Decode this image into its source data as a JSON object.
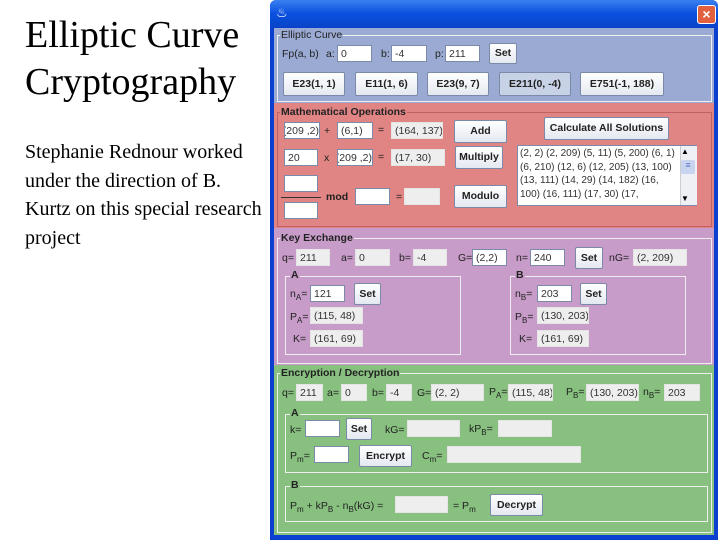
{
  "slide": {
    "title_line1": "Elliptic Curve",
    "title_line2": "Cryptography",
    "body": "Stephanie Rednour worked under the direction of B. Kurtz on this special research project"
  },
  "window": {
    "close_icon": "×",
    "app_icon": "java-cup-icon"
  },
  "colors": {
    "curve_panel": "#9aaad2",
    "math_panel": "#e08484",
    "key_panel": "#c89cc8",
    "enc_panel": "#88c080",
    "titlebar": "#0a50e0"
  },
  "curve": {
    "title": "Elliptic Curve",
    "fp_label": "Fp(a, b)",
    "a_label": "a:",
    "a": "0",
    "b_label": "b:",
    "b": "-4",
    "p_label": "p:",
    "p": "211",
    "set": "Set",
    "presets": [
      "E23(1, 1)",
      "E11(1, 6)",
      "E23(9, 7)",
      "E211(0, -4)",
      "E751(-1, 188)"
    ]
  },
  "math": {
    "title": "Mathematical Operations",
    "add_p1": "(2, 209)",
    "plus": "+",
    "add_p2": "(6,1)",
    "eq": "=",
    "add_result": "(164, 137)",
    "add": "Add",
    "mul_k": "20",
    "times": "x",
    "mul_p": "(2, 209)",
    "mul_result": "(17, 30)",
    "multiply": "Multiply",
    "num": "",
    "den": "",
    "mod_label": "mod",
    "mod": "",
    "mod_result": "",
    "modulo": "Modulo",
    "calc_all": "Calculate All Solutions",
    "solutions": "(2, 2) (2, 209) (5, 11) (5, 200) (6, 1) (6, 210) (12, 6) (12, 205) (13, 100) (13, 111) (14, 29) (14, 182) (16, 100) (16, 111) (17, 30) (17,"
  },
  "key": {
    "title": "Key Exchange",
    "q": "211",
    "a": "0",
    "b": "-4",
    "G": "(2,2)",
    "n": "240",
    "set": "Set",
    "nG": "(2, 209)",
    "A": {
      "title": "A",
      "nA": "121",
      "set": "Set",
      "PA": "(115, 48)",
      "K": "(161, 69)"
    },
    "B": {
      "title": "B",
      "nB": "203",
      "set": "Set",
      "PB": "(130, 203)",
      "K": "(161, 69)"
    }
  },
  "enc": {
    "title": "Encryption / Decryption",
    "q": "211",
    "a": "0",
    "b": "-4",
    "G": "(2, 2)",
    "PA": "(115, 48)",
    "PB": "(130, 203)",
    "nB": "203",
    "A": {
      "title": "A",
      "k": "",
      "set": "Set",
      "kG": "",
      "kPB": "",
      "Pm": "",
      "encrypt": "Encrypt",
      "Cm": ""
    },
    "B": {
      "title": "B",
      "result": "",
      "decrypt": "Decrypt"
    }
  }
}
